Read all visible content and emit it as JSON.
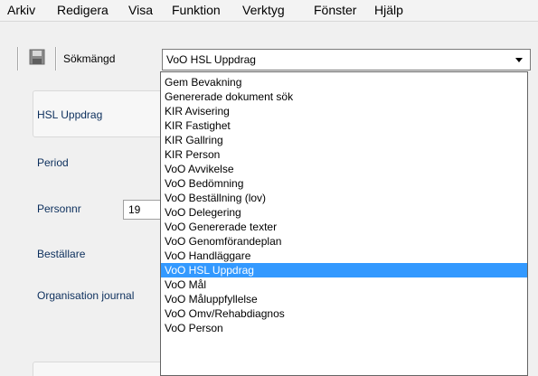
{
  "menu": [
    "Arkiv",
    "Redigera",
    "Visa",
    "Funktion",
    "Verktyg",
    "Fönster",
    "Hjälp"
  ],
  "toolbar": {
    "save_icon": "floppy-disk-icon",
    "label": "Sökmängd"
  },
  "combo": {
    "value": "VoO HSL Uppdrag"
  },
  "form": {
    "panel_title": "HSL Uppdrag",
    "period_label": "Period",
    "personnr_label": "Personnr",
    "personnr_value": "19",
    "bestallare_label": "Beställare",
    "organisation_label": "Organisation journal"
  },
  "dropdown": {
    "selected": "VoO HSL Uppdrag",
    "options": [
      "Gem Bevakning",
      "Genererade dokument sök",
      "KIR Avisering",
      "KIR Fastighet",
      "KIR Gallring",
      "KIR Person",
      "VoO Avvikelse",
      "VoO Bedömning",
      "VoO Beställning (lov)",
      "VoO Delegering",
      "VoO Genererade texter",
      "VoO Genomförandeplan",
      "VoO Handläggare",
      "VoO HSL Uppdrag",
      "VoO Mål",
      "VoO Måluppfyllelse",
      "VoO Omv/Rehabdiagnos",
      "VoO Person"
    ]
  }
}
